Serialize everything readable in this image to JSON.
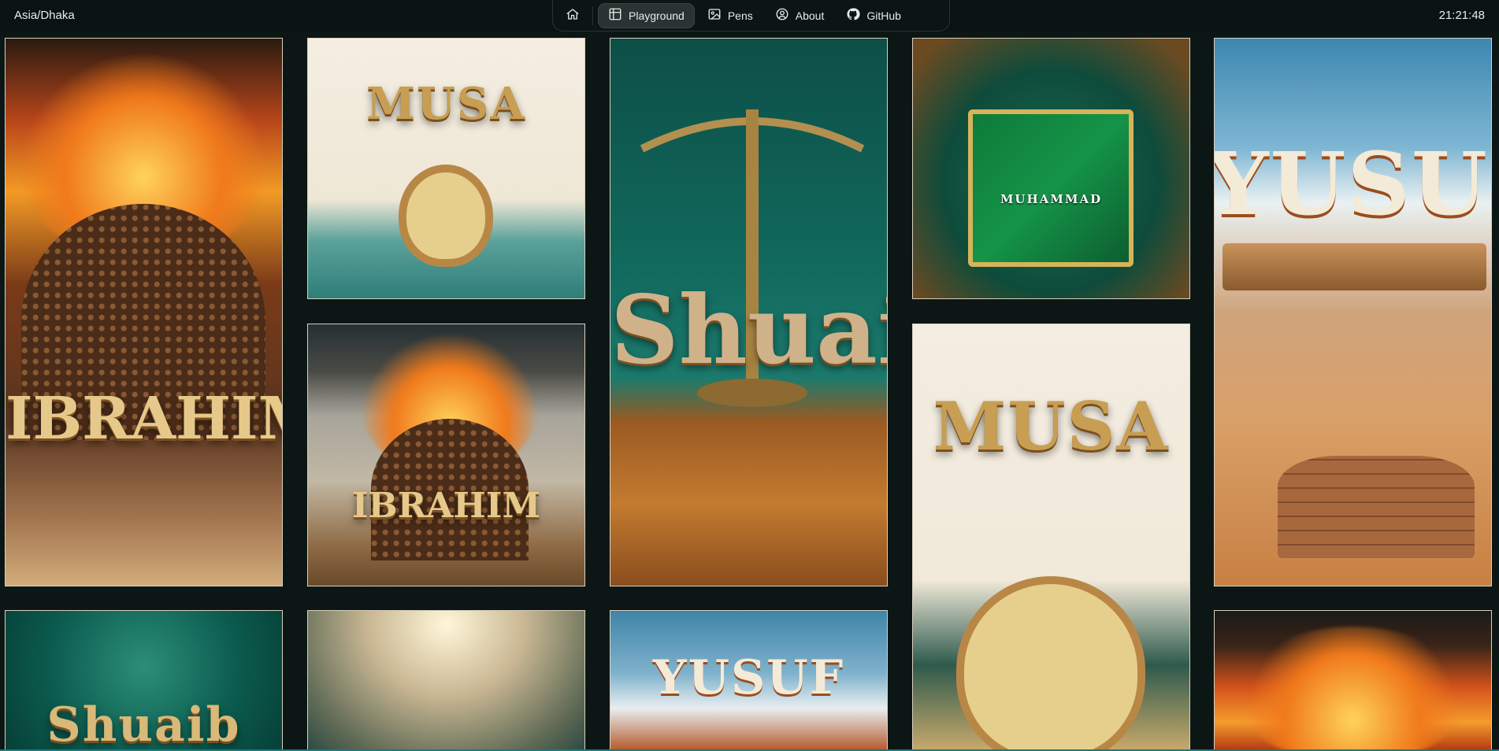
{
  "header": {
    "timezone": "Asia/Dhaka",
    "time": "21:21:48"
  },
  "nav": {
    "items": [
      {
        "icon": "home-icon",
        "label": ""
      },
      {
        "icon": "grid-icon",
        "label": "Playground",
        "active": true
      },
      {
        "icon": "image-icon",
        "label": "Pens"
      },
      {
        "icon": "user-circle-icon",
        "label": "About"
      },
      {
        "icon": "github-icon",
        "label": "GitHub"
      }
    ]
  },
  "gallery": {
    "tiles": [
      {
        "word": "IBRAHIM"
      },
      {
        "word": "MUSA"
      },
      {
        "word": "IBRAHIM"
      },
      {
        "word": "Shuaib"
      },
      {
        "word": "MUHAMMAD"
      },
      {
        "word": "MUSA"
      },
      {
        "word": "YUSUF"
      },
      {
        "word": "Shuaib"
      },
      {
        "word": ""
      },
      {
        "word": "YUSUF"
      },
      {
        "word": ""
      }
    ]
  },
  "colors": {
    "page_bg": "#0c1715",
    "topbar_bg": "#0a1312",
    "active_tab_bg": "#2a3331",
    "accent_line": "#1f7a78"
  }
}
